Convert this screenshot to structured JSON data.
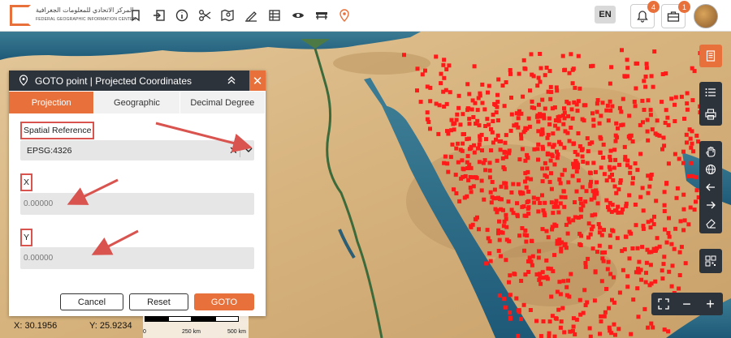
{
  "header": {
    "logo_arabic": "المركز الاتحادي للمعلومات الجغرافية",
    "logo_english": "FEDERAL GEOGRAPHIC INFORMATION CENTER",
    "tools": [
      "bookmark-icon",
      "goto-icon",
      "info-icon",
      "scissors-icon",
      "map-edit-icon",
      "draw-icon",
      "table-icon",
      "eye-icon",
      "bench-icon",
      "pin-icon"
    ],
    "language": "EN",
    "notifications_count": "4",
    "briefcase_count": "1"
  },
  "panel": {
    "title": "GOTO point | Projected Coordinates",
    "tabs": [
      {
        "label": "Projection",
        "active": true
      },
      {
        "label": "Geographic",
        "active": false
      },
      {
        "label": "Decimal Degree",
        "active": false
      }
    ],
    "spatial_reference_label": "Spatial Reference",
    "spatial_reference_value": "EPSG:4326",
    "x_label": "X",
    "x_placeholder": "0.00000",
    "y_label": "Y",
    "y_placeholder": "0.00000",
    "cancel_label": "Cancel",
    "reset_label": "Reset",
    "goto_label": "GOTO"
  },
  "status": {
    "x_readout": "X: 30.1956",
    "y_readout": "Y: 25.9234",
    "scale_labels": [
      "0",
      "250 km",
      "500 km"
    ]
  },
  "colors": {
    "accent": "#e8703a",
    "dark": "#2d333b",
    "points": "#ff1a1a",
    "annotation": "#d9534f"
  }
}
